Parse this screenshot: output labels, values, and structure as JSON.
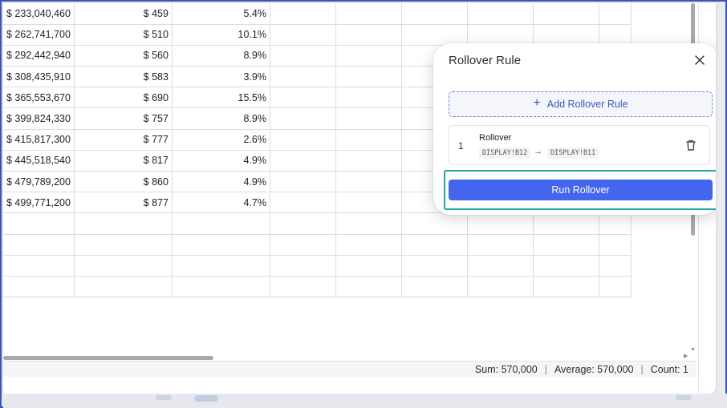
{
  "grid": {
    "rows": [
      [
        "$ 233,040,460",
        "$ 459",
        "5.4%"
      ],
      [
        "$ 262,741,700",
        "$ 510",
        "10.1%"
      ],
      [
        "$ 292,442,940",
        "$ 560",
        "8.9%"
      ],
      [
        "$ 308,435,910",
        "$ 583",
        "3.9%"
      ],
      [
        "$ 365,553,670",
        "$ 690",
        "15.5%"
      ],
      [
        "$ 399,824,330",
        "$ 757",
        "8.9%"
      ],
      [
        "$ 415,817,300",
        "$ 777",
        "2.6%"
      ],
      [
        "$ 445,518,540",
        "$ 817",
        "4.9%"
      ],
      [
        "$ 479,789,200",
        "$ 860",
        "4.9%"
      ],
      [
        "$ 499,771,200",
        "$ 877",
        "4.7%"
      ],
      [
        "",
        "",
        ""
      ],
      [
        "",
        "",
        ""
      ],
      [
        "",
        "",
        ""
      ],
      [
        "",
        "",
        ""
      ]
    ]
  },
  "statusbar": {
    "sum": "Sum: 570,000",
    "average": "Average: 570,000",
    "count": "Count: 1",
    "separator": "|"
  },
  "rollover_panel": {
    "title": "Rollover Rule",
    "add_button_label": "Add Rollover Rule",
    "rules": [
      {
        "index": "1",
        "name": "Rollover",
        "from": "DISPLAY!B12",
        "to": "DISPLAY!B11"
      }
    ],
    "run_button_label": "Run Rollover"
  },
  "colors": {
    "accent": "#4466ee",
    "highlight": "#1fa7a0",
    "dashed_border": "#6b86c9"
  },
  "icons": {
    "close": "close-icon",
    "plus": "plus-icon",
    "arrow": "arrow-right-icon",
    "delete": "trash-icon"
  }
}
